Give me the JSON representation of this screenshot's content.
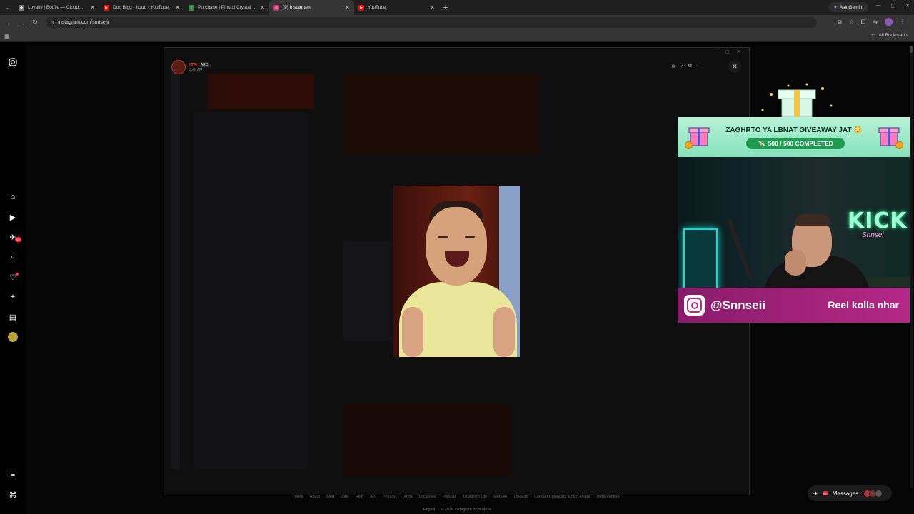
{
  "browser": {
    "tabs": [
      {
        "title": "Loyalty | Botfile — Cloud Streami",
        "icon": "loyalty-favicon",
        "color": "#888888"
      },
      {
        "title": "Don Bigg - Itoub - YouTube",
        "icon": "youtube-favicon",
        "color": "#ff0000"
      },
      {
        "title": "Purchase | Plmaxi Crystal Supen",
        "icon": "store-favicon",
        "color": "#2b8a3e"
      },
      {
        "title": "(9) Instagram",
        "icon": "instagram-favicon",
        "color": "#d62976"
      },
      {
        "title": "YouTube",
        "icon": "youtube-favicon",
        "color": "#ff0000"
      }
    ],
    "active_tab": 3,
    "new_tab": "+",
    "ask_gemini": "Ask Gemini",
    "url": "instagram.com/snnseii/",
    "all_bookmarks": "All Bookmarks"
  },
  "rail": {
    "notifications_badge": "9+",
    "icons": [
      "instagram-icon",
      "home-icon",
      "reels-icon",
      "messages-icon",
      "search-icon",
      "heart-icon",
      "create-icon",
      "dashboard-icon",
      "profile-icon",
      "menu-icon",
      "meta-icon"
    ]
  },
  "story": {
    "name": "ITS",
    "tag": "ARC",
    "time": "3:48 AM"
  },
  "overlay": {
    "banner_title": "ZAGHRTO YA LBNAT GIVEAWAY JAT 😳",
    "progress_text": "500 / 500 COMPLETED",
    "progress_current": 500,
    "progress_total": 500,
    "neon_sign": "KICK",
    "neon_sub": "Snnsei",
    "handle": "@Snnseii",
    "cta": "Reel kolla nhar"
  },
  "footer": {
    "links": [
      "Meta",
      "About",
      "Blog",
      "Jobs",
      "Help",
      "API",
      "Privacy",
      "Terms",
      "Locations",
      "Popular",
      "Instagram Lite",
      "Meta AI",
      "Threads",
      "Contact Uploading & Non-Users",
      "Meta Verified"
    ],
    "language": "English",
    "copyright": "© 2026 Instagram from Meta"
  },
  "messages": {
    "label": "Messages",
    "badge": "9+"
  },
  "colors": {
    "accent_ig": "#c02b85",
    "banner_green": "#1f9a4f",
    "badge_red": "#ff3040"
  }
}
